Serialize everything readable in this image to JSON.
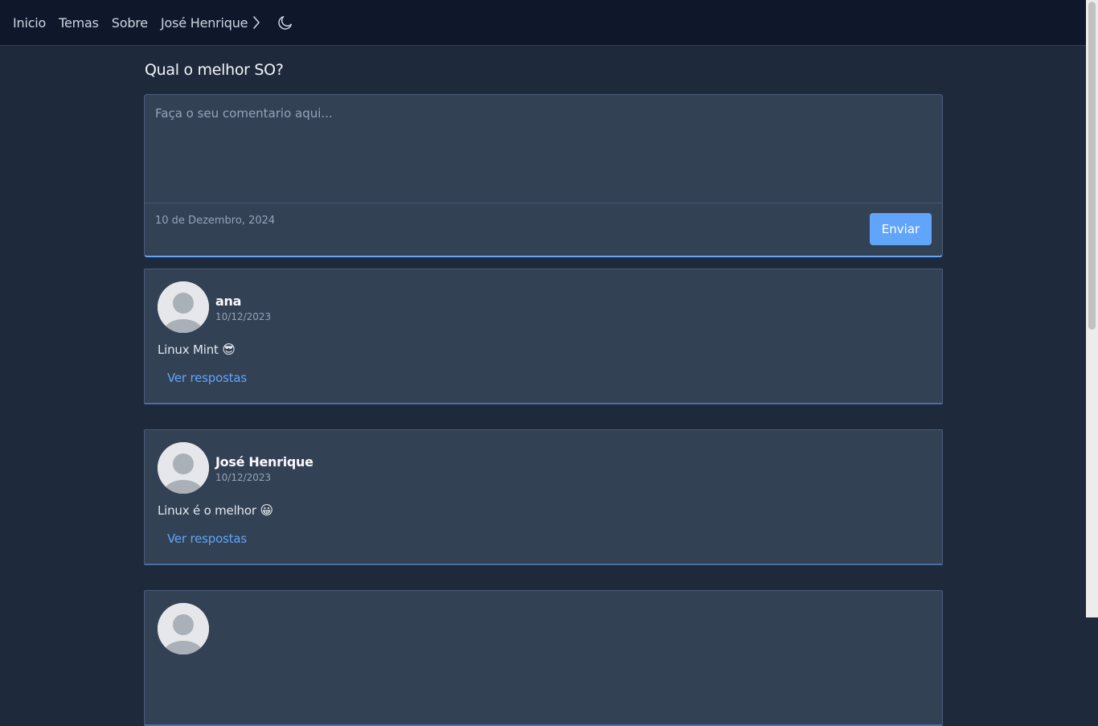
{
  "nav": {
    "links": [
      "Inicio",
      "Temas",
      "Sobre"
    ],
    "user_name": "José Henrique"
  },
  "topic": {
    "title": "Qual o melhor SO?"
  },
  "comment_form": {
    "placeholder": "Faça o seu comentario aqui...",
    "value": "",
    "date": "10 de Dezembro, 2024",
    "submit_label": "Enviar"
  },
  "comments": [
    {
      "author": "ana",
      "date": "10/12/2023",
      "text": "Linux Mint",
      "emoji": "😎",
      "replies_label": "Ver respostas"
    },
    {
      "author": "José Henrique",
      "date": "10/12/2023",
      "text": "Linux é o melhor",
      "emoji": "😀",
      "replies_label": "Ver respostas"
    },
    {
      "author": "",
      "date": "",
      "text": "",
      "emoji": "",
      "replies_label": ""
    }
  ],
  "colors": {
    "background": "#1e293b",
    "navbar": "#0f172a",
    "card": "#334155",
    "accent": "#60a5fa"
  },
  "icons": {
    "chevron": "chevron-right-icon",
    "theme": "moon-icon",
    "avatar": "default-user-avatar"
  }
}
